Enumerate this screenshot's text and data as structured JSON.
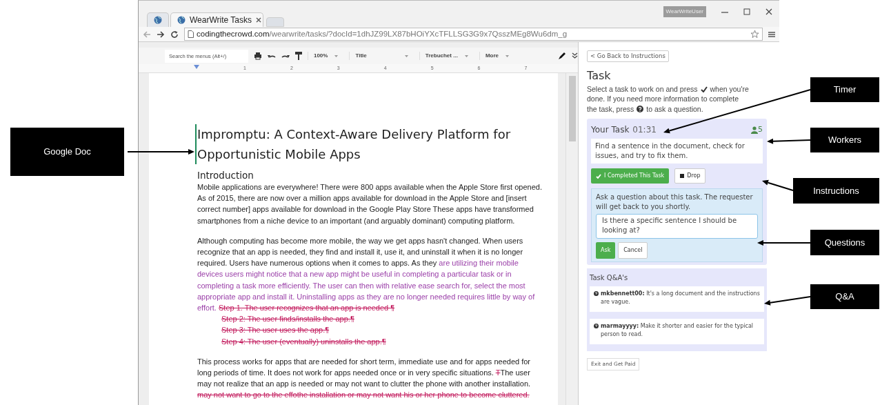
{
  "browser": {
    "tabs": [
      {
        "selected": false
      },
      {
        "label": "WearWrite Tasks",
        "selected": true
      }
    ],
    "user_badge": "WearWriteUser",
    "url": {
      "host": "codingthecrowd.com",
      "path": "/wearwrite/tasks/?docId=1dhJZ99LX87bHOiYXcTFLLSG3G9x7QsszMEg8Wu6dm_g"
    }
  },
  "doc_toolbar": {
    "search_placeholder": "Search the menus (Alt+/)",
    "zoom": "100%",
    "style": "Title",
    "font": "Trebuchet ...",
    "more": "More"
  },
  "ruler_marks": [
    "1",
    "2",
    "3",
    "4",
    "5",
    "6",
    "7"
  ],
  "document": {
    "title": "Impromptu: A Context-Aware Delivery Platform for Opportunistic Mobile Apps",
    "heading": "Introduction",
    "paragraphs": [
      {
        "kind": "body",
        "runs": [
          {
            "kind": "normal",
            "text": "Mobile applications are everywhere!  There were 800 apps available when the Apple Store first opened. As of 2015, there are now over a million apps available for download in the Apple Store and [insert correct number] apps available for download in the Google Play Store These apps have transformed smartphones from a niche device to an important (and arguably dominant) computing platform."
          }
        ]
      },
      {
        "kind": "body",
        "runs": [
          {
            "kind": "normal",
            "text": "Although computing has become more mobile, the way we get apps hasn't changed.  When users recognize that an app is needed, they find and install it, use it, and uninstall it when it is no longer required. Users have numerous options when it comes to apps. As they "
          },
          {
            "kind": "suggested",
            "text": "are utilizing their mobile devices users might notice that a new app might be useful in completing a particular task or in completing a task more efficiently. The user can then with relative ease search for, select the most appropriate app and install it. Uninstalling apps as they are no longer needed requires little by way of effort. "
          },
          {
            "kind": "deleted",
            "text": "Step 1. The user recognizes that an app is needed ¶"
          }
        ]
      },
      {
        "kind": "step",
        "runs": [
          {
            "kind": "deleted",
            "text": "Step 2: The user finds/installs the app.¶"
          }
        ]
      },
      {
        "kind": "step",
        "runs": [
          {
            "kind": "deleted",
            "text": "Step 3: The user uses the app.¶"
          }
        ]
      },
      {
        "kind": "step",
        "runs": [
          {
            "kind": "deleted",
            "text": "Step 4:  The user (eventually) uninstalls the app.¶"
          }
        ]
      },
      {
        "kind": "body",
        "runs": [
          {
            "kind": "normal",
            "text": "This process works for apps that are needed for short term, immediate use and for apps needed for long periods of time.  It does not work for apps needed once or in very specific situations. "
          },
          {
            "kind": "deleted",
            "text": "T"
          },
          {
            "kind": "normal",
            "text": "The user may not realize that an app is needed or may not want to clutter the phone with another installation. "
          },
          {
            "kind": "deleted",
            "text": "may not want to go to the effothe installation or may not want his or her phone to become cluttered."
          }
        ]
      }
    ]
  },
  "panel": {
    "back_button": "< Go Back to Instructions",
    "title": "Task",
    "intro": [
      {
        "kind": "text",
        "text": "Select a task to work on and press"
      },
      {
        "kind": "check"
      },
      {
        "kind": "text",
        "text": "when you're"
      },
      {
        "kind": "break"
      },
      {
        "kind": "text",
        "text": "done. If you need more information to complete"
      },
      {
        "kind": "break"
      },
      {
        "kind": "text",
        "text": "the task, press"
      },
      {
        "kind": "question"
      },
      {
        "kind": "text",
        "text": "to ask a question."
      }
    ],
    "task": {
      "label": "Your Task",
      "timer": "01:31",
      "workers": "5",
      "description": "Find a sentence in the document, check for issues, and try to fix them.",
      "complete_button": "I Completed This Task",
      "drop_button": "Drop"
    },
    "question": {
      "prompt": "Ask a question about this task. The requester will get back to you shortly.",
      "value": "Is there a specific sentence I should be looking at?",
      "ask_button": "Ask",
      "cancel_button": "Cancel"
    },
    "qa": {
      "title": "Task Q&A's",
      "entries": [
        {
          "text": "**mkbennett00:** It's a long document and the instructions are vague."
        },
        {
          "text": "**marmayyyy:** Make it shorter and easier for the typical person to read."
        }
      ]
    },
    "exit_button": "Exit and Get Paid"
  },
  "callouts": [
    {
      "label": "Google Doc"
    },
    {
      "label": "Timer"
    },
    {
      "label": "Workers"
    },
    {
      "label": "Instructions"
    },
    {
      "label": "Questions"
    },
    {
      "label": "Q&A"
    }
  ]
}
